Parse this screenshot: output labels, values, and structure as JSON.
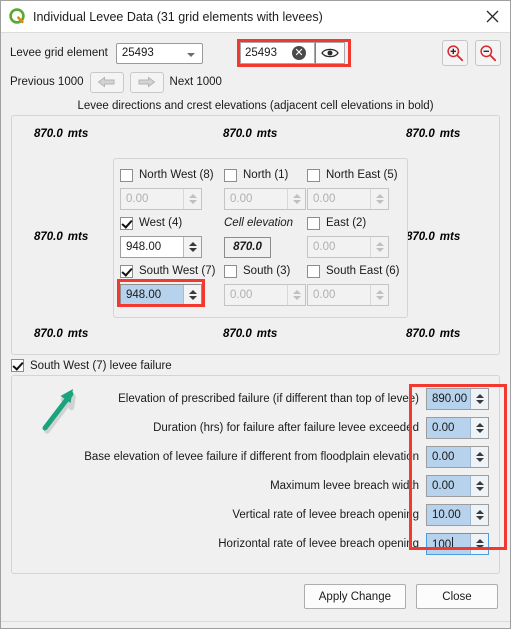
{
  "window": {
    "title": "Individual Levee Data (31 grid elements with levees)",
    "logo_icon": "qgis-logo-icon",
    "close_icon": "close-icon"
  },
  "toolbar": {
    "grid_element_label": "Levee grid element",
    "grid_element_value": "25493",
    "search_value": "25493",
    "search_placeholder": "",
    "clear_icon": "clear-circle-icon",
    "eye_icon": "eye-icon",
    "zoom_in_icon": "zoom-in-icon",
    "zoom_out_icon": "zoom-out-icon",
    "previous_label": "Previous 1000",
    "next_label": "Next 1000",
    "prev_icon": "arrow-left-icon",
    "next_icon": "arrow-right-icon",
    "highlight_color": "#f3392f"
  },
  "directions": {
    "caption": "Levee directions and crest elevations (adjacent cell elevations in bold)",
    "corner_labels": [
      {
        "value": "870.0",
        "unit": "mts"
      },
      {
        "value": "870.0",
        "unit": "mts"
      },
      {
        "value": "870.0",
        "unit": "mts"
      },
      {
        "value": "870.0",
        "unit": "mts"
      },
      {
        "value": "870.0",
        "unit": "mts"
      },
      {
        "value": "870.0",
        "unit": "mts"
      },
      {
        "value": "870.0",
        "unit": "mts"
      },
      {
        "value": "870.0",
        "unit": "mts"
      }
    ],
    "cells": [
      {
        "label": "North West (8)",
        "checked": false,
        "value": "0.00",
        "enabled": false,
        "selected": false
      },
      {
        "label": "North (1)",
        "checked": false,
        "value": "0.00",
        "enabled": false,
        "selected": false
      },
      {
        "label": "North East (5)",
        "checked": false,
        "value": "0.00",
        "enabled": false,
        "selected": false
      },
      {
        "label": "West (4)",
        "checked": true,
        "value": "948.00",
        "enabled": true,
        "selected": false
      },
      {
        "label": "East (2)",
        "checked": false,
        "value": "0.00",
        "enabled": false,
        "selected": false
      },
      {
        "label": "South West (7)",
        "checked": true,
        "value": "948.00",
        "enabled": true,
        "selected": true
      },
      {
        "label": "South (3)",
        "checked": false,
        "value": "0.00",
        "enabled": false,
        "selected": false
      },
      {
        "label": "South East (6)",
        "checked": false,
        "value": "0.00",
        "enabled": false,
        "selected": false
      }
    ],
    "cell_elevation_label": "Cell elevation",
    "cell_elevation_value": "870.0"
  },
  "failure": {
    "checkbox_label": "South West (7)  levee failure",
    "checked": true,
    "rows": [
      {
        "label": "Elevation of prescribed failure (if different than top of levee)",
        "value": "890.00",
        "focused": false
      },
      {
        "label": "Duration (hrs) for failure after failure levee exceeded",
        "value": "0.00",
        "focused": false
      },
      {
        "label": "Base elevation of levee failure if different from floodplain elevation",
        "value": "0.00",
        "focused": false
      },
      {
        "label": "Maximum levee breach width",
        "value": "0.00",
        "focused": false
      },
      {
        "label": "Vertical rate of levee breach opening",
        "value": "10.00",
        "focused": false
      },
      {
        "label": "Horizontal rate of levee breach opening",
        "value": "100",
        "focused": true
      }
    ]
  },
  "annotation": {
    "arrow_color": "#1aa47d",
    "arrow_icon": "annotation-arrow-icon"
  },
  "buttons": {
    "apply_label": "Apply Change",
    "close_label": "Close"
  }
}
